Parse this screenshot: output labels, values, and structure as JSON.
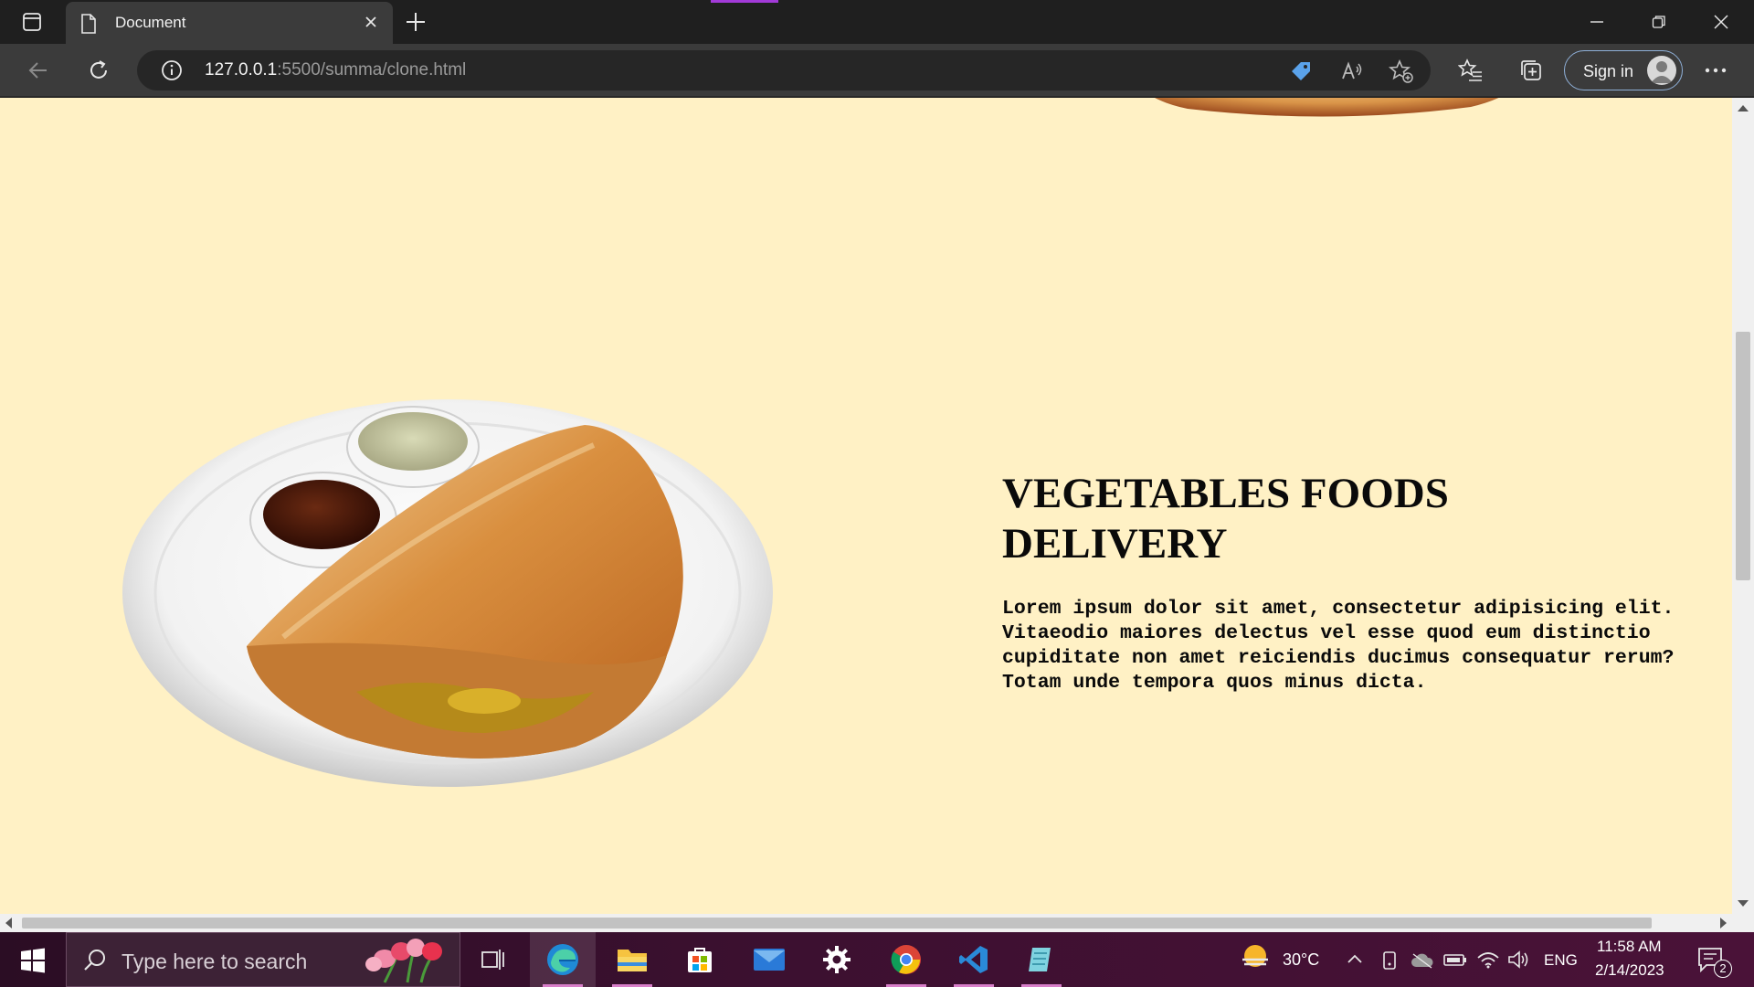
{
  "browser": {
    "tab_title": "Document",
    "url_host": "127.0.0.1",
    "url_path": ":5500/summa/clone.html",
    "sign_in_label": "Sign in"
  },
  "page": {
    "heading_line1": "VEGETABLES FOODS",
    "heading_line2": "DELIVERY",
    "description_lines": [
      "Lorem ipsum dolor sit amet, consectetur adipisicing elit.",
      "Vitaeodio maiores delectus vel esse quod eum distinctio",
      "cupiditate non amet reiciendis ducimus consequatur rerum?",
      "Totam unde tempora quos minus dicta."
    ],
    "background_color": "#fff1c5"
  },
  "taskbar": {
    "search_placeholder": "Type here to search",
    "weather_temp": "30°C",
    "language": "ENG",
    "time": "11:58 AM",
    "date": "2/14/2023",
    "notification_count": "2",
    "apps": [
      "task-view",
      "edge",
      "file-explorer",
      "microsoft-store",
      "mail",
      "settings",
      "chrome",
      "vscode",
      "notepad"
    ]
  }
}
